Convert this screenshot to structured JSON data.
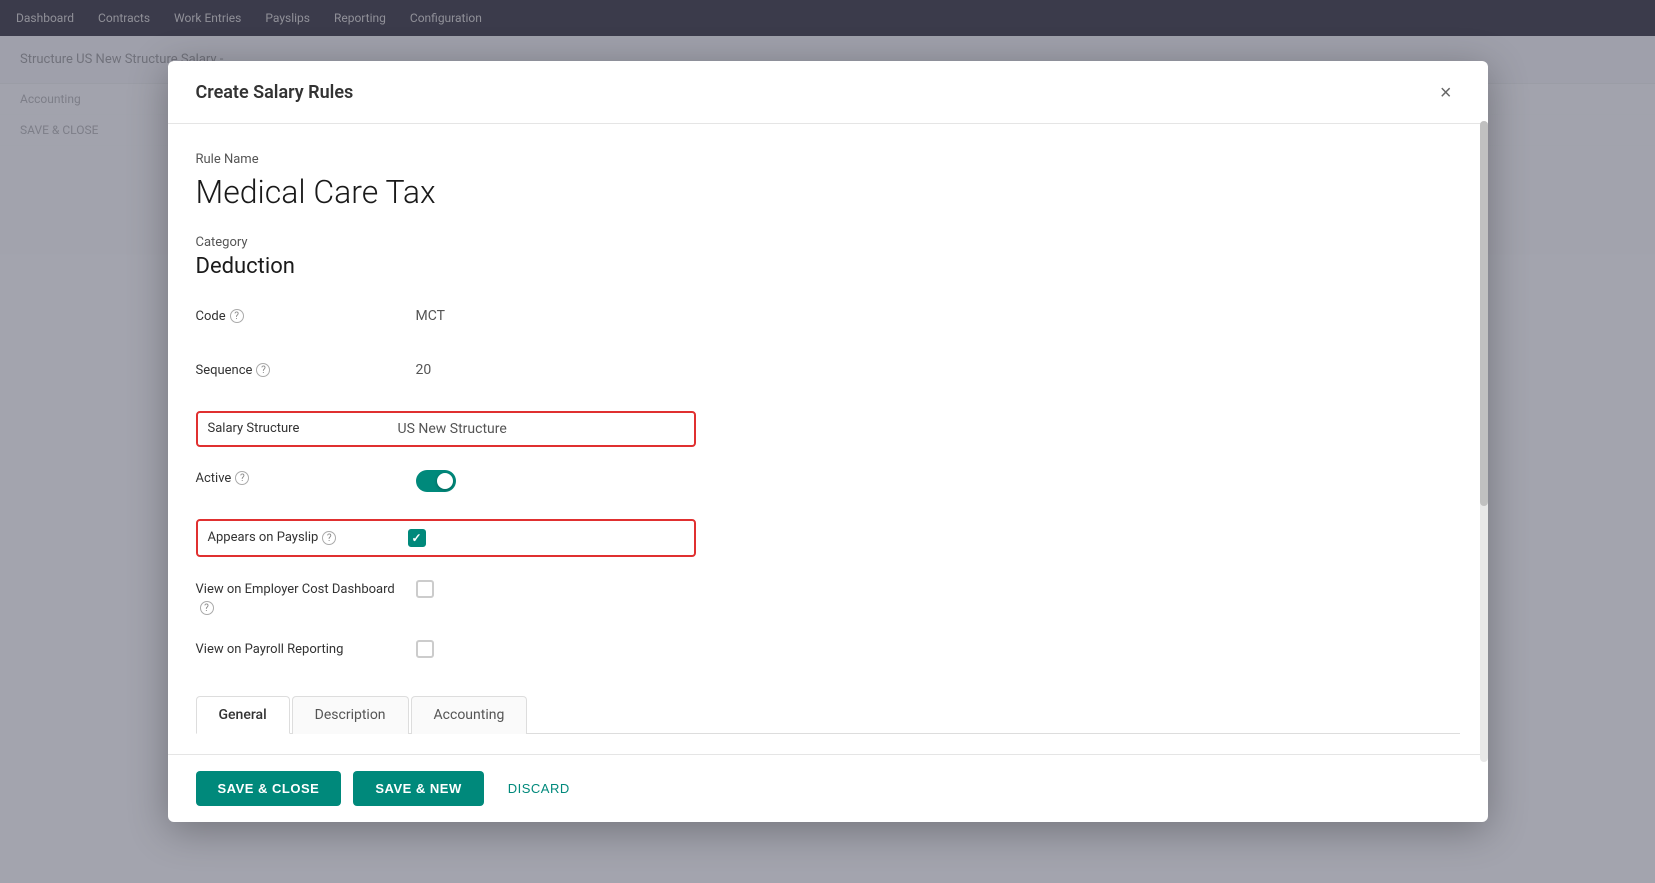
{
  "modal": {
    "title": "Create Salary Rules",
    "close_label": "×",
    "rule_name_label": "Rule Name",
    "rule_name_value": "Medical Care Tax",
    "category_label": "Category",
    "category_value": "Deduction",
    "fields": {
      "code_label": "Code",
      "code_help": "?",
      "code_value": "MCT",
      "sequence_label": "Sequence",
      "sequence_help": "?",
      "sequence_value": "20",
      "salary_structure_label": "Salary Structure",
      "salary_structure_value": "US New Structure",
      "active_label": "Active",
      "active_help": "?",
      "appears_on_payslip_label": "Appears on Payslip",
      "appears_on_payslip_help": "?",
      "employer_cost_label": "View on Employer Cost Dashboard",
      "employer_cost_help": "?",
      "payroll_reporting_label": "View on Payroll Reporting"
    },
    "tabs": [
      {
        "id": "general",
        "label": "General",
        "active": true
      },
      {
        "id": "description",
        "label": "Description",
        "active": false
      },
      {
        "id": "accounting",
        "label": "Accounting",
        "active": false
      }
    ],
    "footer": {
      "save_close_label": "SAVE & CLOSE",
      "save_new_label": "SAVE & NEW",
      "discard_label": "DISCARD"
    }
  }
}
